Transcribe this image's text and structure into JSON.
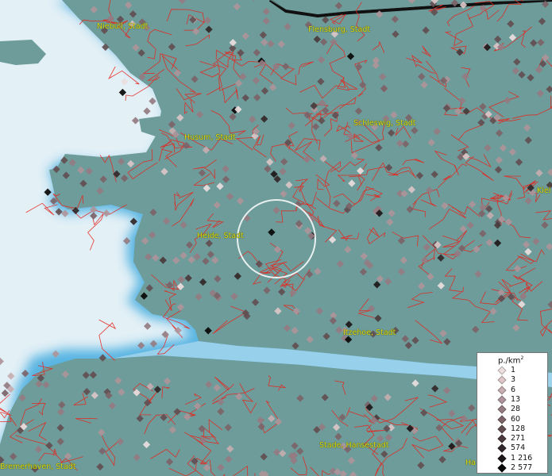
{
  "map": {
    "colors": {
      "land": "#6d9c9a",
      "sea": "#e3f0f6",
      "coast_glow": "#4aaee0",
      "borders": "#e8241c",
      "label_text": "#dcdc10"
    },
    "selection_marker": "circle"
  },
  "labels": {
    "niebull": "Niebüll, Stadt",
    "flensburg": "Flensburg, Stadt",
    "schleswig": "Schleswig, Stadt",
    "husum": "Husum, Stadt",
    "heide": "Heide, Stadt",
    "itzehoe": "Itzehoe, Stadt",
    "stade": "Stade, Hansestadt",
    "bremerhaven": "Bremerhaven, Stadt",
    "kiel": "Kiel",
    "hamburg": "Ha"
  },
  "legend": {
    "title": "p./km",
    "title_sup": "2",
    "classes": [
      {
        "label": "1",
        "color": "#ecdede"
      },
      {
        "label": "3",
        "color": "#dcc6c7"
      },
      {
        "label": "6",
        "color": "#c6aeb1"
      },
      {
        "label": "13",
        "color": "#ae959a"
      },
      {
        "label": "28",
        "color": "#957c82"
      },
      {
        "label": "60",
        "color": "#7c6468"
      },
      {
        "label": "128",
        "color": "#624e51"
      },
      {
        "label": "271",
        "color": "#4a3a3c"
      },
      {
        "label": "574",
        "color": "#332829"
      },
      {
        "label": "1 216",
        "color": "#1e1718"
      },
      {
        "label": "2 577",
        "color": "#0a0707"
      }
    ]
  }
}
